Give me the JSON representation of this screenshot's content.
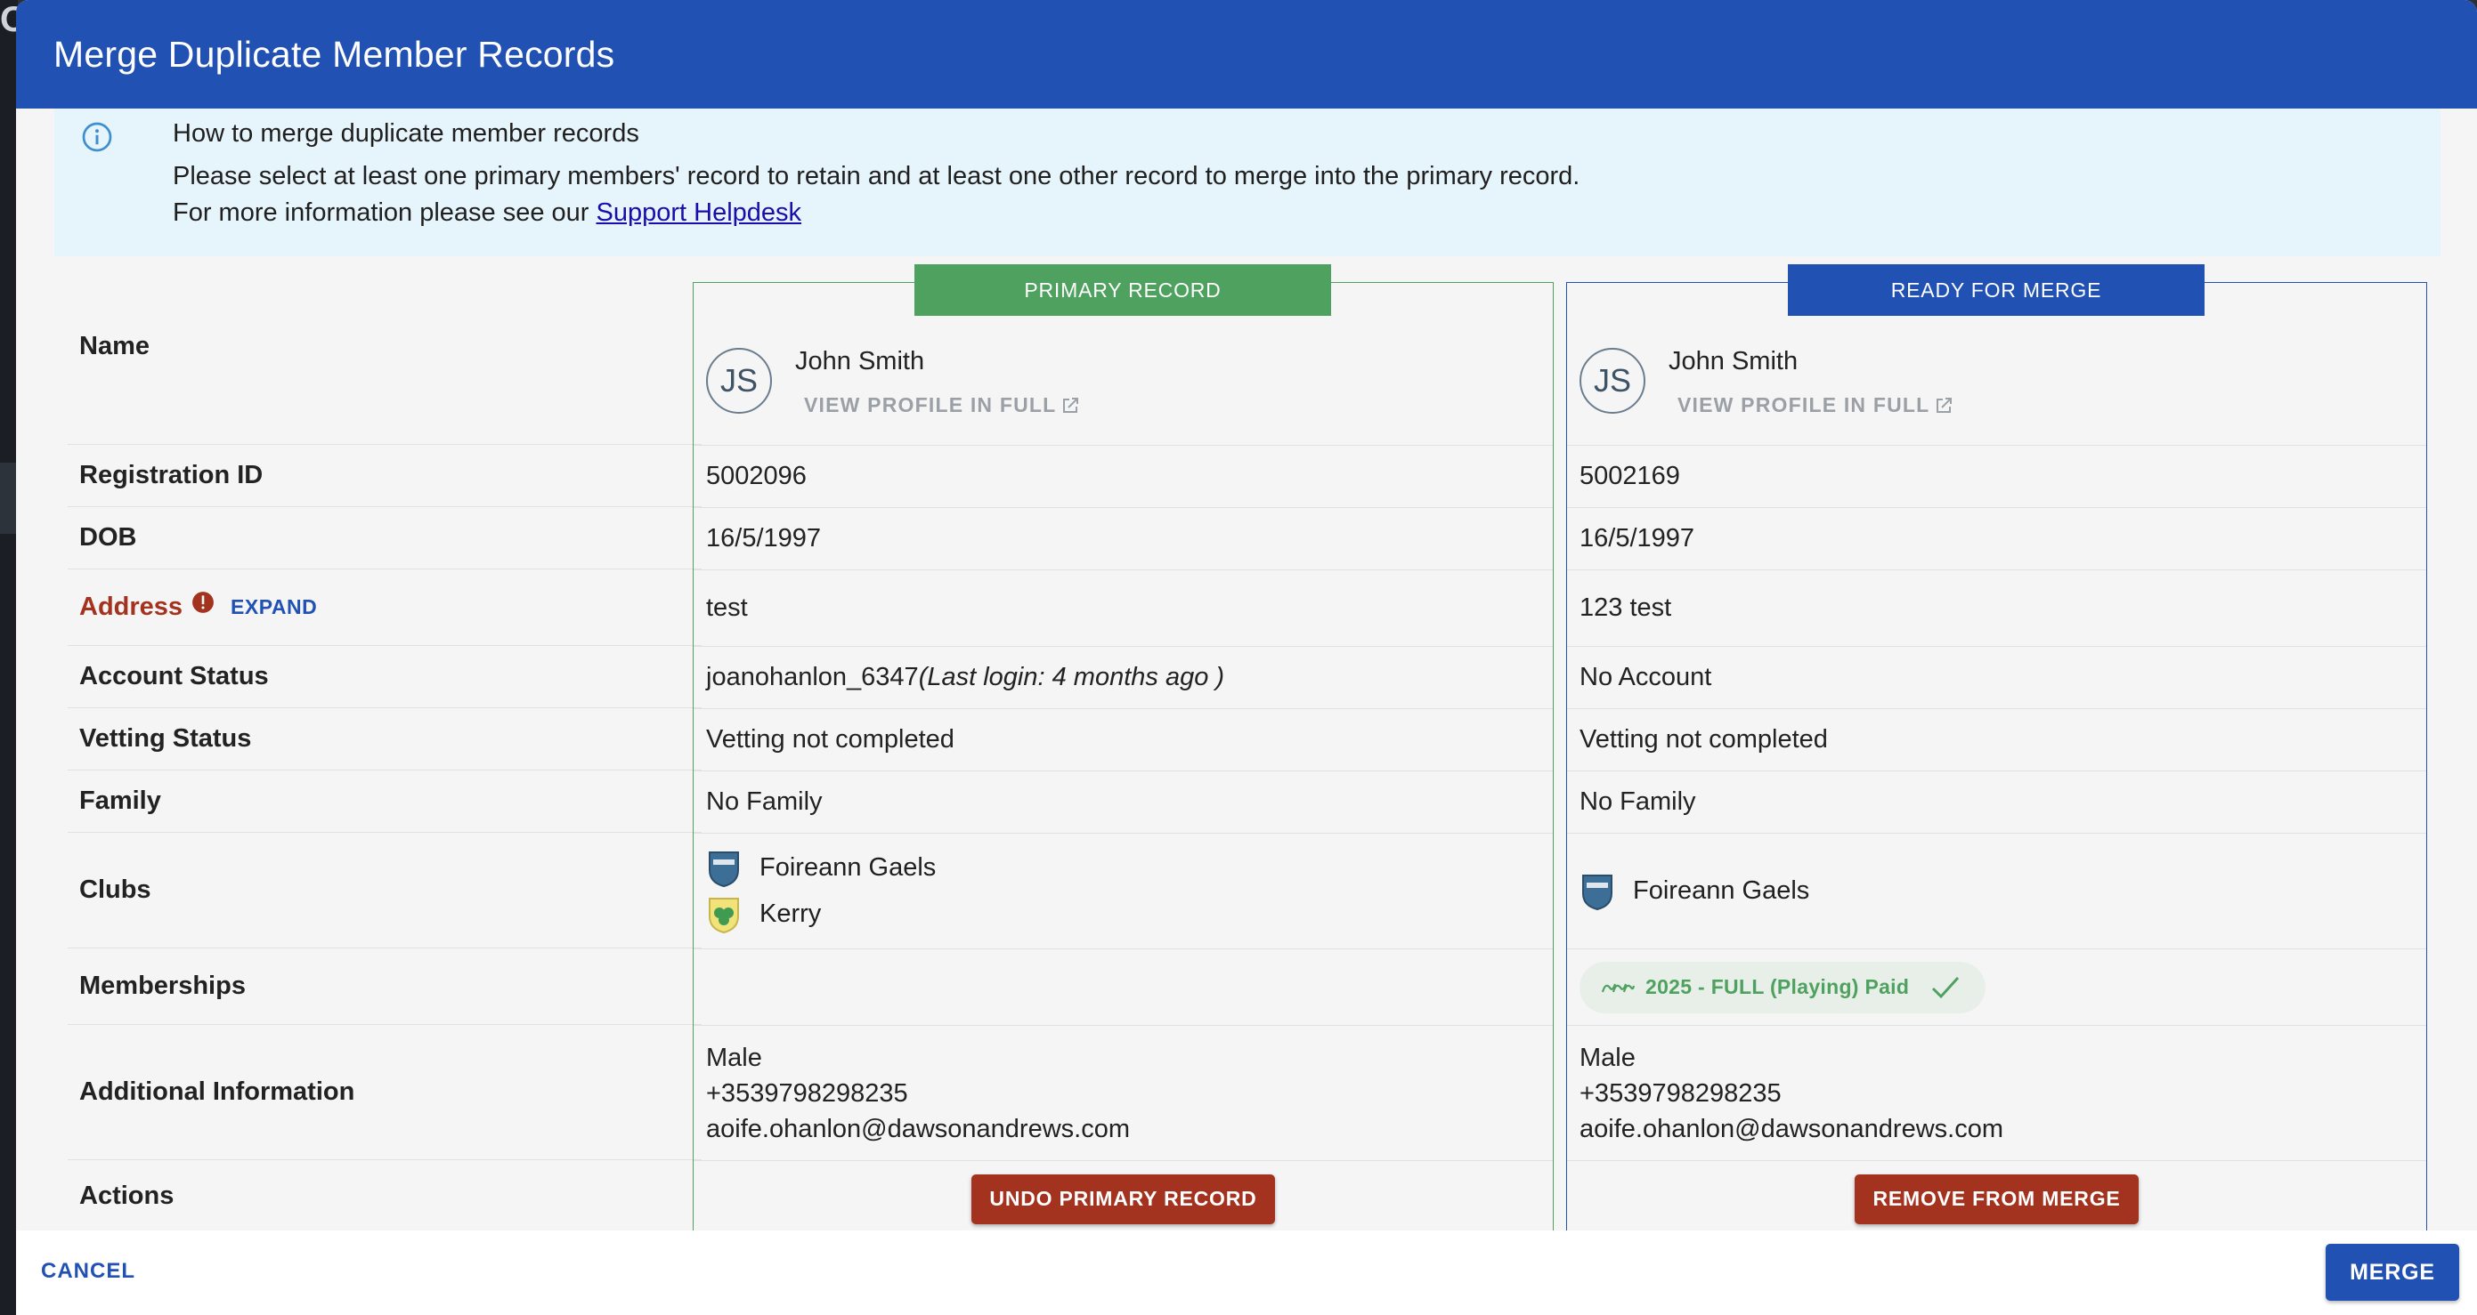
{
  "background": {
    "fragment": "O"
  },
  "dialog": {
    "title": "Merge Duplicate Member Records"
  },
  "info": {
    "heading": "How to merge duplicate member records",
    "line1": "Please select at least one primary members' record to retain and at least one other record to merge into the primary record.",
    "line2_prefix": "For more information please see our ",
    "link": "Support Helpdesk"
  },
  "labels": {
    "name": "Name",
    "registration_id": "Registration ID",
    "dob": "DOB",
    "address": "Address",
    "expand": "EXPAND",
    "account_status": "Account Status",
    "vetting_status": "Vetting Status",
    "family": "Family",
    "clubs": "Clubs",
    "memberships": "Memberships",
    "additional_information": "Additional Information",
    "actions": "Actions"
  },
  "primary": {
    "tag": "PRIMARY RECORD",
    "initials": "JS",
    "name": "John Smith",
    "view_profile": "VIEW PROFILE IN FULL",
    "registration_id": "5002096",
    "dob": "16/5/1997",
    "address": "test",
    "account_username": "joanohanlon_6347",
    "account_last_login": "(Last login: 4 months ago )",
    "vetting_status": "Vetting not completed",
    "family": "No Family",
    "clubs": [
      "Foireann Gaels",
      "Kerry"
    ],
    "gender": "Male",
    "phone": "+3539798298235",
    "email": "aoife.ohanlon@dawsonandrews.com",
    "action": "UNDO PRIMARY RECORD"
  },
  "merge_record": {
    "tag": "READY FOR MERGE",
    "initials": "JS",
    "name": "John Smith",
    "view_profile": "VIEW PROFILE IN FULL",
    "registration_id": "5002169",
    "dob": "16/5/1997",
    "address": "123 test",
    "account_status": "No Account",
    "vetting_status": "Vetting not completed",
    "family": "No Family",
    "clubs": [
      "Foireann Gaels"
    ],
    "membership": "2025 - FULL (Playing) Paid",
    "gender": "Male",
    "phone": "+3539798298235",
    "email": "aoife.ohanlon@dawsonandrews.com",
    "action": "REMOVE FROM MERGE"
  },
  "footer": {
    "cancel": "CANCEL",
    "merge": "MERGE"
  },
  "colors": {
    "header": "#2151b3",
    "primary_green": "#4ea15e",
    "danger_red": "#a3321f",
    "info_bg": "#e6f4fb"
  }
}
